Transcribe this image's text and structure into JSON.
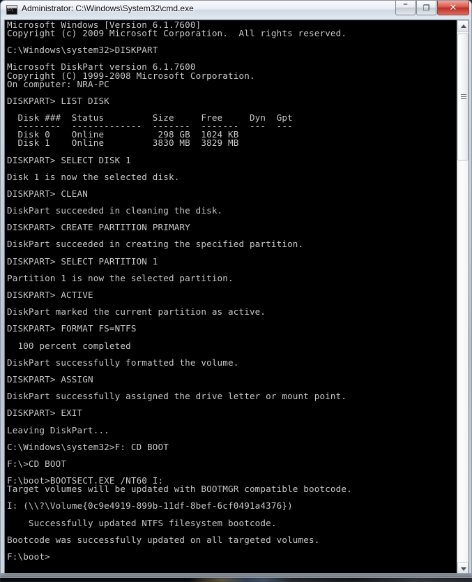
{
  "window": {
    "title": "Administrator: C:\\Windows\\System32\\cmd.exe",
    "icon_name": "cmd-console-icon",
    "buttons": {
      "minimize_label": "–",
      "maximize_label": "❐",
      "close_label": "✕"
    }
  },
  "scrollbar": {
    "up_arrow_label": "",
    "down_arrow_label": "",
    "position_percent": 0
  },
  "colors": {
    "console_background": "#000000",
    "console_foreground": "#c8c8c8",
    "titlebar_text": "#0b0d12",
    "close_button": "#b92f25"
  },
  "console": {
    "prompt_current": "F:\\boot>",
    "lines": [
      "Microsoft Windows [Version 6.1.7600]",
      "Copyright (c) 2009 Microsoft Corporation.  All rights reserved.",
      "",
      "C:\\Windows\\system32>DISKPART",
      "",
      "Microsoft DiskPart version 6.1.7600",
      "Copyright (C) 1999-2008 Microsoft Corporation.",
      "On computer: NRA-PC",
      "",
      "DISKPART> LIST DISK",
      "",
      "  Disk ###  Status         Size     Free     Dyn  Gpt",
      "  --------  -------------  -------  -------  ---  ---",
      "  Disk 0    Online          298 GB  1024 KB",
      "  Disk 1    Online         3830 MB  3829 MB",
      "",
      "DISKPART> SELECT DISK 1",
      "",
      "Disk 1 is now the selected disk.",
      "",
      "DISKPART> CLEAN",
      "",
      "DiskPart succeeded in cleaning the disk.",
      "",
      "DISKPART> CREATE PARTITION PRIMARY",
      "",
      "DiskPart succeeded in creating the specified partition.",
      "",
      "DISKPART> SELECT PARTITION 1",
      "",
      "Partition 1 is now the selected partition.",
      "",
      "DISKPART> ACTIVE",
      "",
      "DiskPart marked the current partition as active.",
      "",
      "DISKPART> FORMAT FS=NTFS",
      "",
      "  100 percent completed",
      "",
      "DiskPart successfully formatted the volume.",
      "",
      "DISKPART> ASSIGN",
      "",
      "DiskPart successfully assigned the drive letter or mount point.",
      "",
      "DISKPART> EXIT",
      "",
      "Leaving DiskPart...",
      "",
      "C:\\Windows\\system32>F: CD BOOT",
      "",
      "F:\\>CD BOOT",
      "",
      "F:\\boot>BOOTSECT.EXE /NT60 I:",
      "Target volumes will be updated with BOOTMGR compatible bootcode.",
      "",
      "I: (\\\\?\\Volume{0c9e4919-899b-11df-8bef-6cf0491a4376})",
      "",
      "    Successfully updated NTFS filesystem bootcode.",
      "",
      "Bootcode was successfully updated on all targeted volumes.",
      "",
      "F:\\boot>"
    ],
    "disk_table": {
      "headers": [
        "Disk ###",
        "Status",
        "Size",
        "Free",
        "Dyn",
        "Gpt"
      ],
      "rows": [
        [
          "Disk 0",
          "Online",
          "298 GB",
          "1024 KB",
          "",
          ""
        ],
        [
          "Disk 1",
          "Online",
          "3830 MB",
          "3829 MB",
          "",
          ""
        ]
      ]
    },
    "commands": [
      "DISKPART",
      "LIST DISK",
      "SELECT DISK 1",
      "CLEAN",
      "CREATE PARTITION PRIMARY",
      "SELECT PARTITION 1",
      "ACTIVE",
      "FORMAT FS=NTFS",
      "ASSIGN",
      "EXIT",
      "F: CD BOOT",
      "CD BOOT",
      "BOOTSECT.EXE /NT60 I:"
    ]
  }
}
